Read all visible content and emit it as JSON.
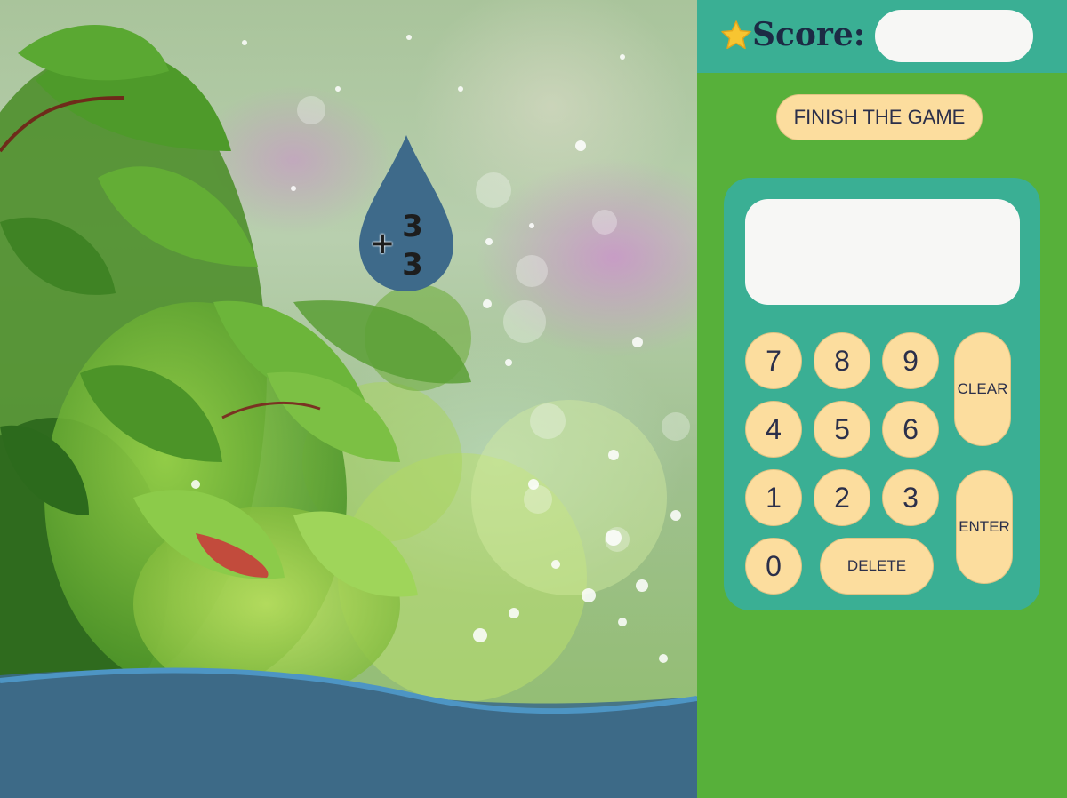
{
  "game": {
    "problem": {
      "operator": "+",
      "top_number": "3",
      "bottom_number": "3",
      "icon": "water-drop-icon"
    }
  },
  "score": {
    "label": "Score:",
    "value": "",
    "icon": "star-icon"
  },
  "controls": {
    "finish_label": "FINISH THE GAME"
  },
  "calculator": {
    "display_value": "",
    "keys": {
      "k7": "7",
      "k8": "8",
      "k9": "9",
      "k4": "4",
      "k5": "5",
      "k6": "6",
      "k1": "1",
      "k2": "2",
      "k3": "3",
      "k0": "0",
      "clear": "CLEAR",
      "enter": "ENTER",
      "delete": "DELETE"
    }
  },
  "colors": {
    "panel_green": "#57b03a",
    "teal": "#3aaf94",
    "key_fill": "#fcdd9e",
    "drop_blue": "#3e6a8a",
    "water_blue": "#3b6a8a"
  }
}
